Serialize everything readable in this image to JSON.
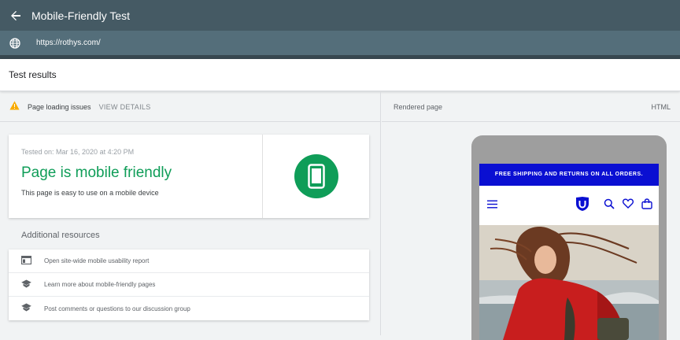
{
  "header": {
    "title": "Mobile-Friendly Test",
    "back_icon": "arrow-left-icon"
  },
  "urlbar": {
    "url": "https://rothys.com/",
    "icon": "globe-icon"
  },
  "results": {
    "title": "Test results"
  },
  "issues": {
    "label": "Page loading issues",
    "action": "VIEW DETAILS",
    "icon": "warning-icon",
    "icon_color": "#f9ab00"
  },
  "result_card": {
    "tested_on": "Tested on: Mar 16, 2020 at 4:20 PM",
    "verdict": "Page is mobile friendly",
    "subtitle": "This page is easy to use on a mobile device",
    "accent": "#0f9d58"
  },
  "resources": {
    "title": "Additional resources",
    "items": [
      {
        "label": "Open site-wide mobile usability report",
        "icon": "dashboard-icon"
      },
      {
        "label": "Learn more about mobile-friendly pages",
        "icon": "school-icon"
      },
      {
        "label": "Post comments or questions to our discussion group",
        "icon": "school-icon"
      }
    ]
  },
  "rendered": {
    "label": "Rendered page",
    "tab": "HTML"
  },
  "preview": {
    "promo": "FREE SHIPPING AND RETURNS ON ALL ORDERS.",
    "promo_color": "#0a0fd2"
  }
}
